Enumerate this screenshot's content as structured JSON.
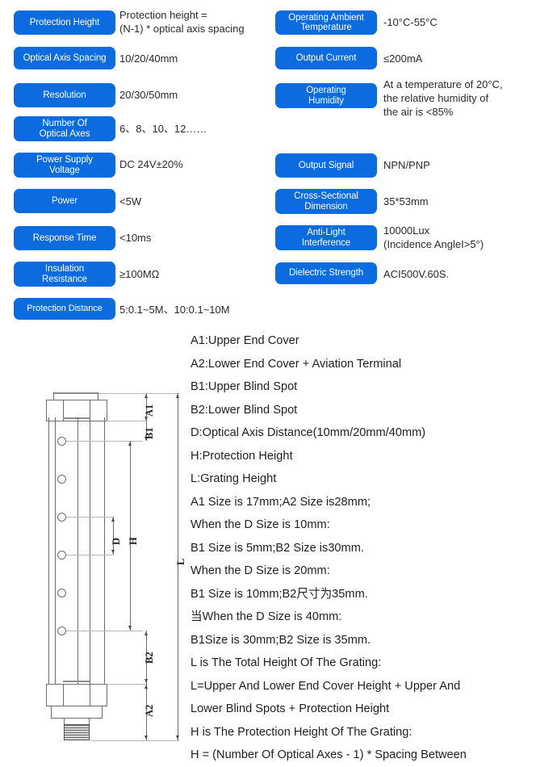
{
  "theme": {
    "badge_bg": "#0b6bdf",
    "badge_text": "#ffffff",
    "body_text": "#231f20",
    "line": "#6f6f6f"
  },
  "spec_table": {
    "left_column": [
      {
        "label": "Protection Height",
        "value": "Protection height =\n (N-1) * optical axis spacing"
      },
      {
        "label": "Optical Axis Spacing",
        "value": "10/20/40mm"
      },
      {
        "label": "Resolution",
        "value": "20/30/50mm"
      },
      {
        "label": "Number Of\nOptical Axes",
        "value": "6、8、10、12……"
      },
      {
        "label": "Power Supply\nVoltage",
        "value": "DC 24V±20%"
      },
      {
        "label": "Power",
        "value": "<5W"
      },
      {
        "label": "Response Time",
        "value": "<10ms"
      },
      {
        "label": "Insulation\nResistance",
        "value": "≥100MΩ"
      },
      {
        "label": "Protection Distance",
        "value": "5:0.1~5M、10:0.1~10M"
      }
    ],
    "right_column": [
      {
        "label": "Operating Ambient\nTemperature",
        "value": "-10°C-55°C"
      },
      {
        "label": "Output Current",
        "value": "≤200mA"
      },
      {
        "label": "Operating\nHumidity",
        "value": "At a temperature of 20°C,\nthe relative humidity of\nthe air is <85%"
      },
      {
        "label": "Output Signal",
        "value": "NPN/PNP"
      },
      {
        "label": "Cross-Sectional\nDimension",
        "value": "35*53mm"
      },
      {
        "label": "Anti-Light\nInterference",
        "value": "10000Lux\n(Incidence AngleI>5°)"
      },
      {
        "label": "Dielectric Strength",
        "value": "ACI500V.60S."
      }
    ]
  },
  "drawing": {
    "dimension_labels": [
      "A1",
      "B1",
      "D",
      "H",
      "L",
      "B2",
      "A2"
    ],
    "optical_axis_count": 6
  },
  "legend": {
    "lines": [
      "A1:Upper End Cover",
      "A2:Lower End Cover + Aviation Terminal",
      "B1:Upper Blind Spot",
      "B2:Lower Blind Spot",
      "D:Optical Axis Distance(10mm/20mm/40mm)",
      "H:Protection Height",
      "L:Grating Height",
      "A1 Size is 17mm;A2 Size is28mm;",
      "When the D Size is 10mm:",
      "B1 Size is 5mm;B2 Size is30mm.",
      "When the D Size is 20mm:",
      "B1 Size is 10mm;B2尺寸为35mm.",
      "当When the D Size is 40mm:",
      "B1Size is 30mm;B2 Size is 35mm.",
      "L is The Total Height Of The Grating:",
      "L=Upper And Lower End Cover Height + Upper And",
      "Lower Blind Spots + Protection Height",
      "H is The Protection Height Of The Grating:",
      "H = (Number Of Optical Axes - 1) * Spacing Between"
    ]
  }
}
